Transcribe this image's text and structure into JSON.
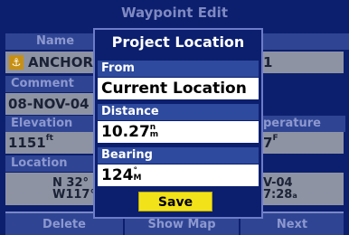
{
  "window_title": "Waypoint Edit",
  "background": {
    "name_label": "Name",
    "name_value": "ANCHOR",
    "comment_label": "Comment",
    "comment_value": "08-NOV-04",
    "elevation_label": "Elevation",
    "elevation_value": "1151",
    "elevation_unit": "ft",
    "temperature_label": "perature",
    "temperature_value": "7",
    "temperature_unit": "F",
    "location_label": "Location",
    "location_lat": "N  32°",
    "location_lon": "W117°",
    "date_partial": "V-04",
    "time_partial": "7:28",
    "time_unit": "a",
    "right_name_partial": "1"
  },
  "buttons": {
    "delete": "Delete",
    "show_map": "Show Map",
    "next": "Next"
  },
  "dialog": {
    "title": "Project Location",
    "from_label": "From",
    "from_value": "Current Location",
    "distance_label": "Distance",
    "distance_value": "10.27",
    "distance_unit_top": "n",
    "distance_unit_bottom": "m",
    "bearing_label": "Bearing",
    "bearing_value": "124",
    "bearing_unit_top": "°",
    "bearing_unit_bottom": "M",
    "save_label": "Save"
  },
  "colors": {
    "screen_bg": "#0c1f6e",
    "header_bg": "#2f4594",
    "field_bg": "#ffffff",
    "save_bg": "#f2e21a"
  },
  "icons": {
    "name_icon": "anchor-icon"
  }
}
